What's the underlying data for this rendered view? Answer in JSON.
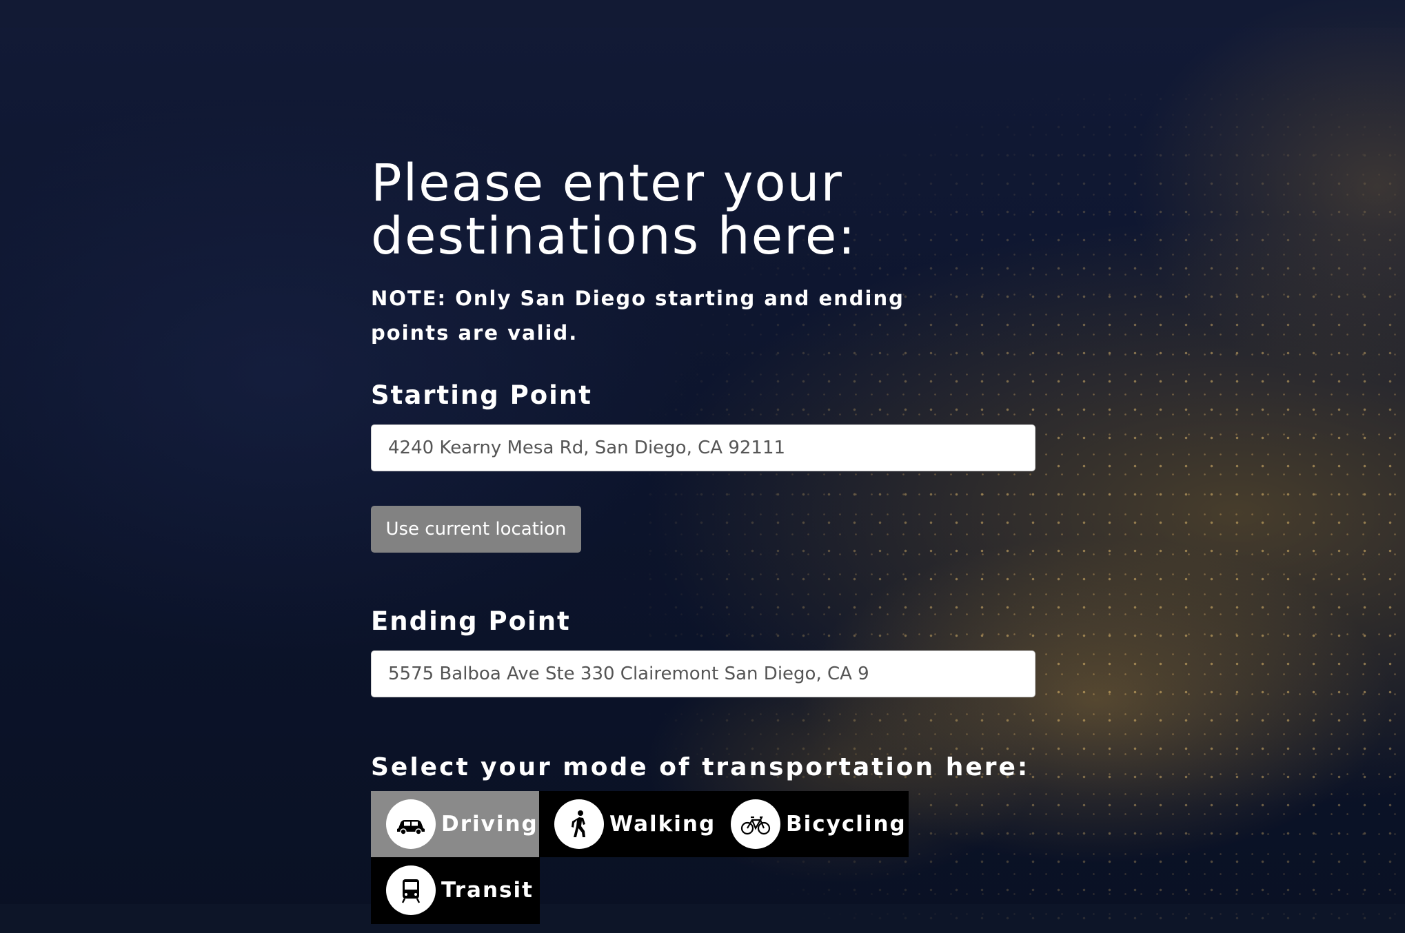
{
  "form": {
    "title": "Please enter your destinations here:",
    "note": "NOTE: Only San Diego starting and ending points are valid.",
    "start_label": "Starting Point",
    "start_value": "4240 Kearny Mesa Rd, San Diego, CA 92111",
    "use_location_label": "Use current location",
    "end_label": "Ending Point",
    "end_value": "5575 Balboa Ave Ste 330 Clairemont San Diego, CA 9",
    "mode_label": "Select your mode of transportation here:",
    "modes": [
      {
        "label": "Driving",
        "icon": "car-icon",
        "selected": true
      },
      {
        "label": "Walking",
        "icon": "pedestrian-icon",
        "selected": false
      },
      {
        "label": "Bicycling",
        "icon": "bicycle-icon",
        "selected": false
      },
      {
        "label": "Transit",
        "icon": "bus-icon",
        "selected": false
      }
    ]
  },
  "colors": {
    "background": "#0b1226",
    "selected_mode": "#8a8a8a",
    "mode_bar": "#000000",
    "button": "#828282",
    "input_text": "#555555"
  }
}
